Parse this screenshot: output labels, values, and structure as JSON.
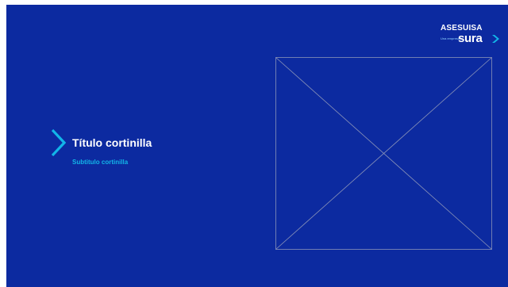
{
  "slide": {
    "title": "Título cortinilla",
    "subtitle": "Subtitulo cortinilla",
    "background_color": "#0c2aa0",
    "accent_color": "#12b5e8",
    "chevron_icon": "chevron-right-icon",
    "image_placeholder_icon": "image-placeholder-icon"
  },
  "logo": {
    "top_text": "ASESUISA",
    "tagline": "Una empresa",
    "brand_text": "sura",
    "brand_icon": "sura-chevron-icon"
  }
}
